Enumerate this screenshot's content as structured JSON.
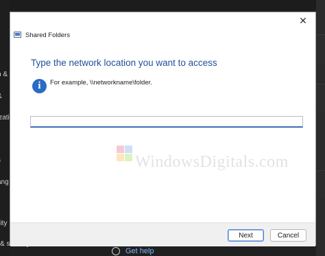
{
  "background": {
    "left_fragments": [
      "h &",
      "&",
      "izati",
      "s",
      "ang",
      "ility",
      "& security"
    ],
    "help_link": "Get help"
  },
  "dialog": {
    "title": "Shared Folders",
    "close_glyph": "✕",
    "heading": "Type the network location you want to access",
    "example": "For example, \\\\networkname\\folder.",
    "input": {
      "value": "",
      "placeholder": ""
    },
    "buttons": {
      "next": "Next",
      "cancel": "Cancel"
    }
  },
  "watermark": {
    "text": "WindowsDigitals.com"
  },
  "colors": {
    "accent": "#1f4e9c",
    "info_icon": "#2a6cc5",
    "focus_border": "#3b6fb6"
  }
}
